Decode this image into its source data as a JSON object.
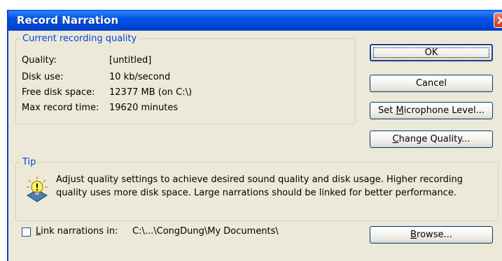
{
  "window": {
    "title": "Record Narration"
  },
  "quality_group": {
    "legend": "Current recording quality",
    "rows": [
      {
        "label": "Quality:",
        "value": "[untitled]"
      },
      {
        "label": "Disk use:",
        "value": "10 kb/second"
      },
      {
        "label": "Free disk space:",
        "value": "12377 MB (on C:\\)"
      },
      {
        "label": "Max record time:",
        "value": "19620 minutes"
      }
    ]
  },
  "buttons": {
    "ok": "OK",
    "cancel": "Cancel",
    "mic_pre": "Set ",
    "mic_key": "M",
    "mic_post": "icrophone Level...",
    "quality_key": "C",
    "quality_post": "hange Quality...",
    "browse_key": "B",
    "browse_post": "rowse..."
  },
  "tip_group": {
    "legend": "Tip",
    "text": "Adjust quality settings to achieve desired sound quality and disk usage. Higher recording quality uses more disk space. Large narrations should be linked for better performance.",
    "icon": "lightbulb-icon"
  },
  "link": {
    "label_key": "L",
    "label_post": "ink narrations in:",
    "checked": false,
    "path": "C:\\...\\CongDung\\My Documents\\"
  },
  "colors": {
    "titlebar": "#0055e5",
    "dialog_bg": "#ece9d8",
    "group_legend": "#0046d5"
  }
}
